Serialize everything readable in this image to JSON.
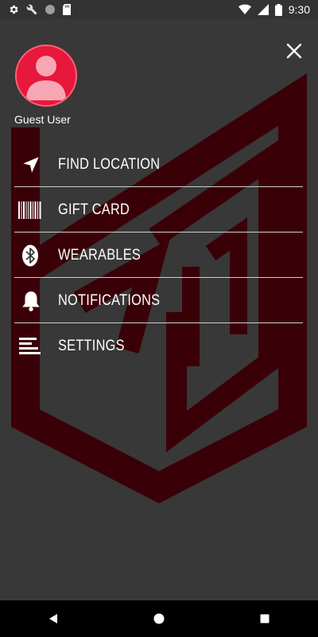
{
  "status_bar": {
    "time": "9:30",
    "left_icons": [
      "gear-icon",
      "wrench-icon",
      "circle-icon",
      "sd-card-icon"
    ],
    "right_icons": [
      "wifi-icon",
      "signal-icon",
      "battery-icon"
    ]
  },
  "drawer": {
    "user_name": "Guest User",
    "avatar_color": "#e8173c",
    "accent_color": "#3a0008",
    "menu": [
      {
        "label": "FIND LOCATION",
        "icon": "navigation-arrow-icon"
      },
      {
        "label": "GIFT CARD",
        "icon": "barcode-icon"
      },
      {
        "label": "WEARABLES",
        "icon": "bluetooth-icon"
      },
      {
        "label": "NOTIFICATIONS",
        "icon": "bell-icon"
      },
      {
        "label": "SETTINGS",
        "icon": "settings-lines-icon"
      }
    ]
  },
  "nav_bar": {
    "buttons": [
      "back-icon",
      "home-icon",
      "recents-icon"
    ]
  }
}
